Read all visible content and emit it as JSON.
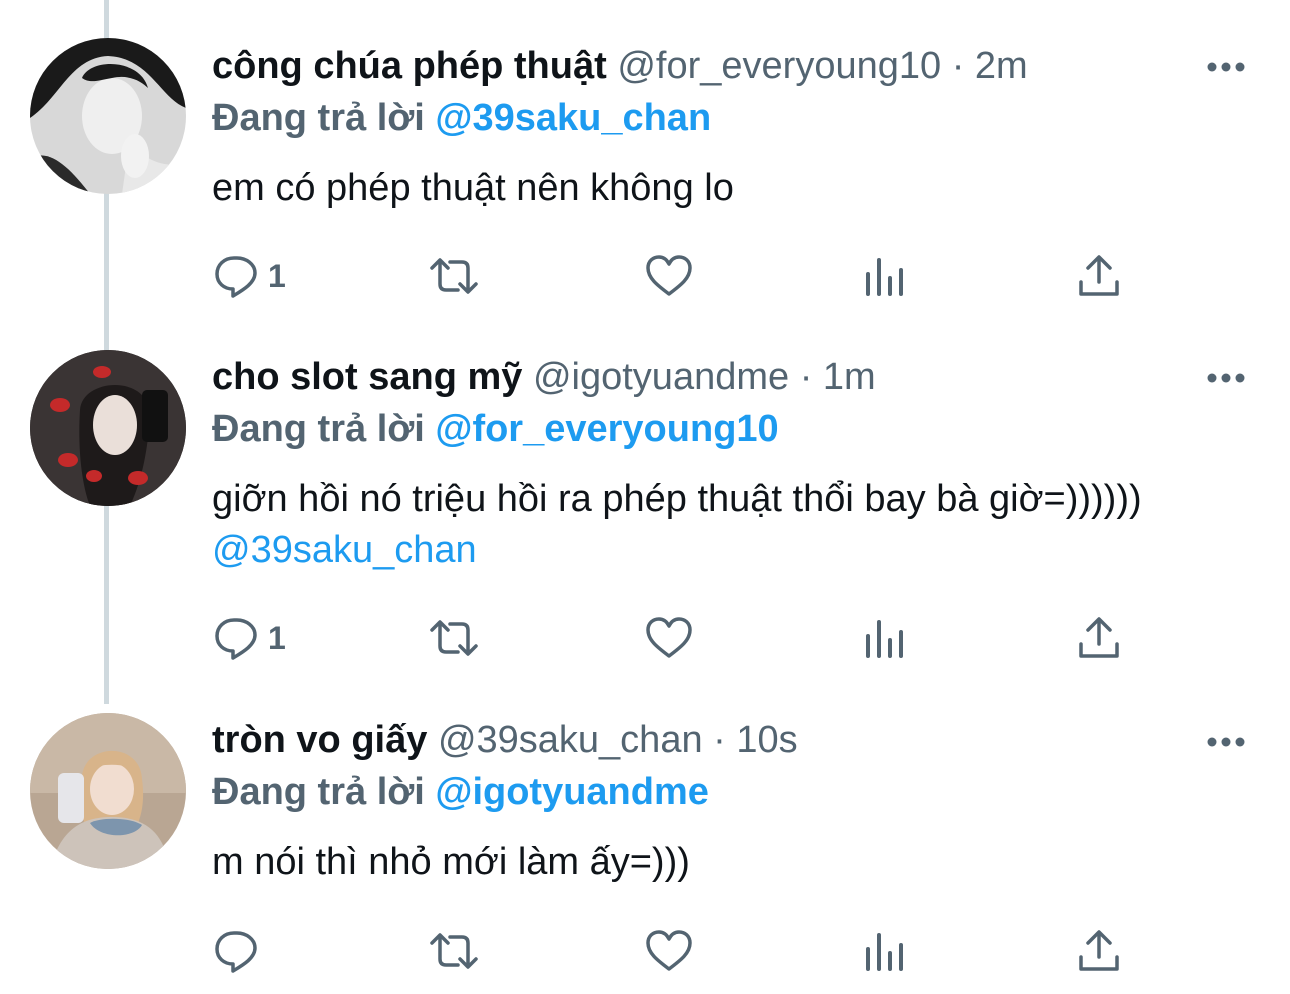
{
  "tweets": [
    {
      "display_name": "công chúa phép thuật",
      "handle": "@for_everyoung10",
      "separator": "·",
      "time": "2m",
      "reply_prefix": "Đang trả lời",
      "reply_to": "@39saku_chan",
      "text": "em có phép thuật nên không lo",
      "mention": "",
      "reply_count": "1"
    },
    {
      "display_name": "cho slot sang mỹ",
      "handle": "@igotyuandme",
      "separator": "·",
      "time": "1m",
      "reply_prefix": "Đang trả lời",
      "reply_to": "@for_everyoung10",
      "text": "giỡn hồi nó triệu hồi ra phép thuật thổi bay bà giờ=))))))",
      "mention": "@39saku_chan",
      "reply_count": "1"
    },
    {
      "display_name": "tròn vo giấy",
      "handle": "@39saku_chan",
      "separator": "·",
      "time": "10s",
      "reply_prefix": "Đang trả lời",
      "reply_to": "@igotyuandme",
      "text": "m nói thì nhỏ mới làm ấy=)))",
      "mention": "",
      "reply_count": ""
    }
  ],
  "colors": {
    "text_primary": "#0f1419",
    "text_secondary": "#536471",
    "link": "#1d9bf0",
    "thread_line": "#cfd9de",
    "background": "#ffffff"
  },
  "icons": [
    "more-icon",
    "reply-icon",
    "retweet-icon",
    "like-icon",
    "views-icon",
    "share-icon"
  ]
}
